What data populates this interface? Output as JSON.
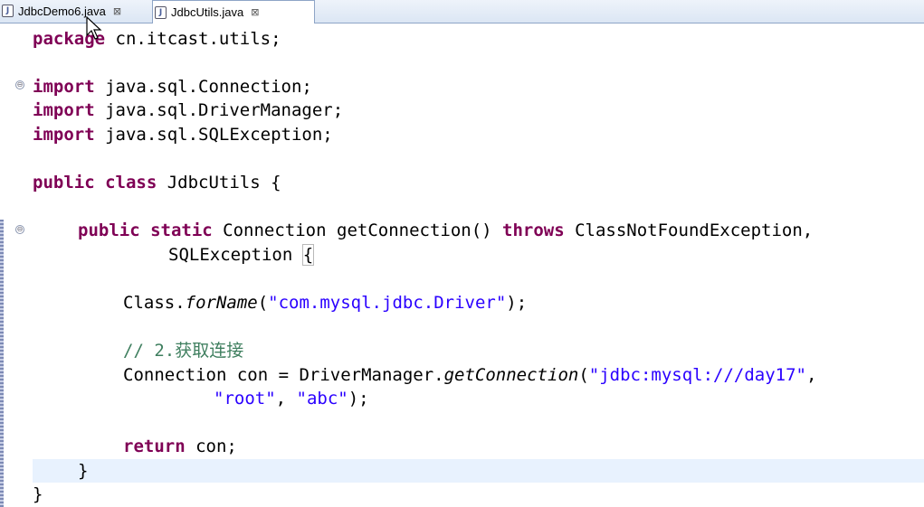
{
  "tabs": [
    {
      "label": "JdbcDemo6.java",
      "icon": "java-file-icon",
      "close": "⊠",
      "active": false
    },
    {
      "label": "JdbcUtils.java",
      "icon": "java-file-icon",
      "close": "⊠",
      "active": true
    }
  ],
  "code": {
    "l1": {
      "kw": "package",
      "rest": " cn.itcast.utils;"
    },
    "l3": {
      "kw": "import",
      "rest": " java.sql.Connection;"
    },
    "l4": {
      "kw": "import",
      "rest": " java.sql.DriverManager;"
    },
    "l5": {
      "kw": "import",
      "rest": " java.sql.SQLException;"
    },
    "l7": {
      "kw1": "public",
      "kw2": "class",
      "rest": " JdbcUtils {"
    },
    "l9": {
      "kw1": "public",
      "kw2": "static",
      "mid": " Connection getConnection() ",
      "kw3": "throws",
      "rest": " ClassNotFoundException,"
    },
    "l10": {
      "text": "SQLException ",
      "brace": "{"
    },
    "l12": {
      "a": "Class.",
      "b": "forName",
      "c": "(",
      "s": "\"com.mysql.jdbc.Driver\"",
      "d": ");"
    },
    "l14": {
      "comment": "// 2.获取连接"
    },
    "l15": {
      "a": "Connection con = DriverManager.",
      "b": "getConnection",
      "c": "(",
      "s": "\"jdbc:mysql:///day17\"",
      "d": ","
    },
    "l16": {
      "s1": "\"root\"",
      "sep": ", ",
      "s2": "\"abc\"",
      "d": ");"
    },
    "l18": {
      "kw": "return",
      "rest": " con;"
    },
    "l19": {
      "text": "}"
    },
    "l20": {
      "text": "}"
    }
  },
  "fold_markers": [
    "⊖",
    "⊖"
  ]
}
